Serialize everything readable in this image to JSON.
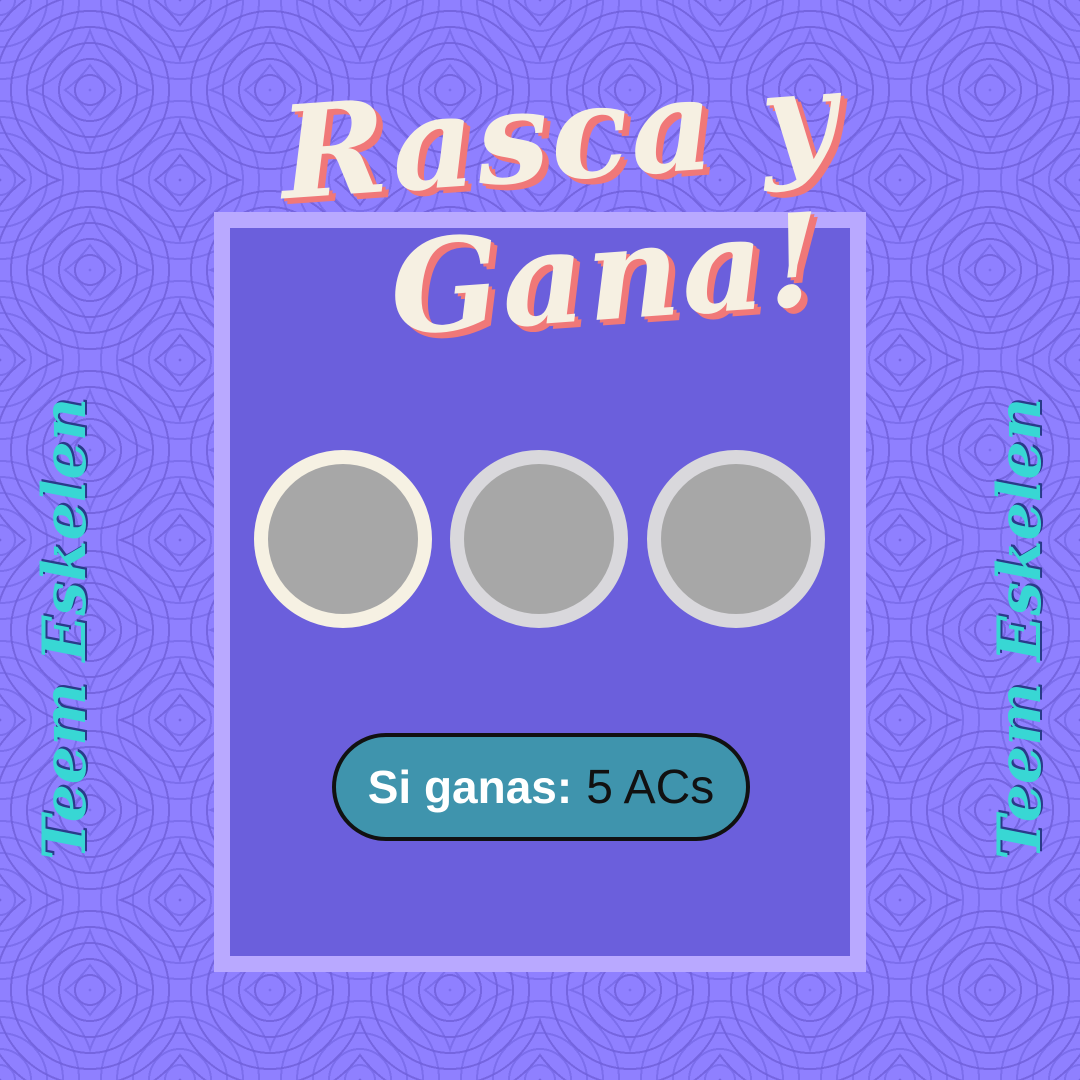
{
  "title": {
    "line1": "Rasca y",
    "line2": "Gana!"
  },
  "side_text": {
    "left": "Teem Eskelen",
    "right": "Teem Eskelen"
  },
  "prize": {
    "label": "Si ganas:",
    "value": "5 ACs"
  },
  "coins": [
    {
      "state": "selected"
    },
    {
      "state": "unscratched"
    },
    {
      "state": "unscratched"
    }
  ],
  "colors": {
    "background": "#8f80ff",
    "card_border": "#b9a9ff",
    "card": "#6b5fdc",
    "title": "#f6f0e2",
    "title_shadow": "#f07878",
    "side_text": "#38d7d4",
    "coin_fill": "#a7a7a7",
    "coin_selected_ring": "#f6f1e3",
    "coin_ring": "#d9d8dc",
    "prize_pill": "#3f94ad"
  }
}
